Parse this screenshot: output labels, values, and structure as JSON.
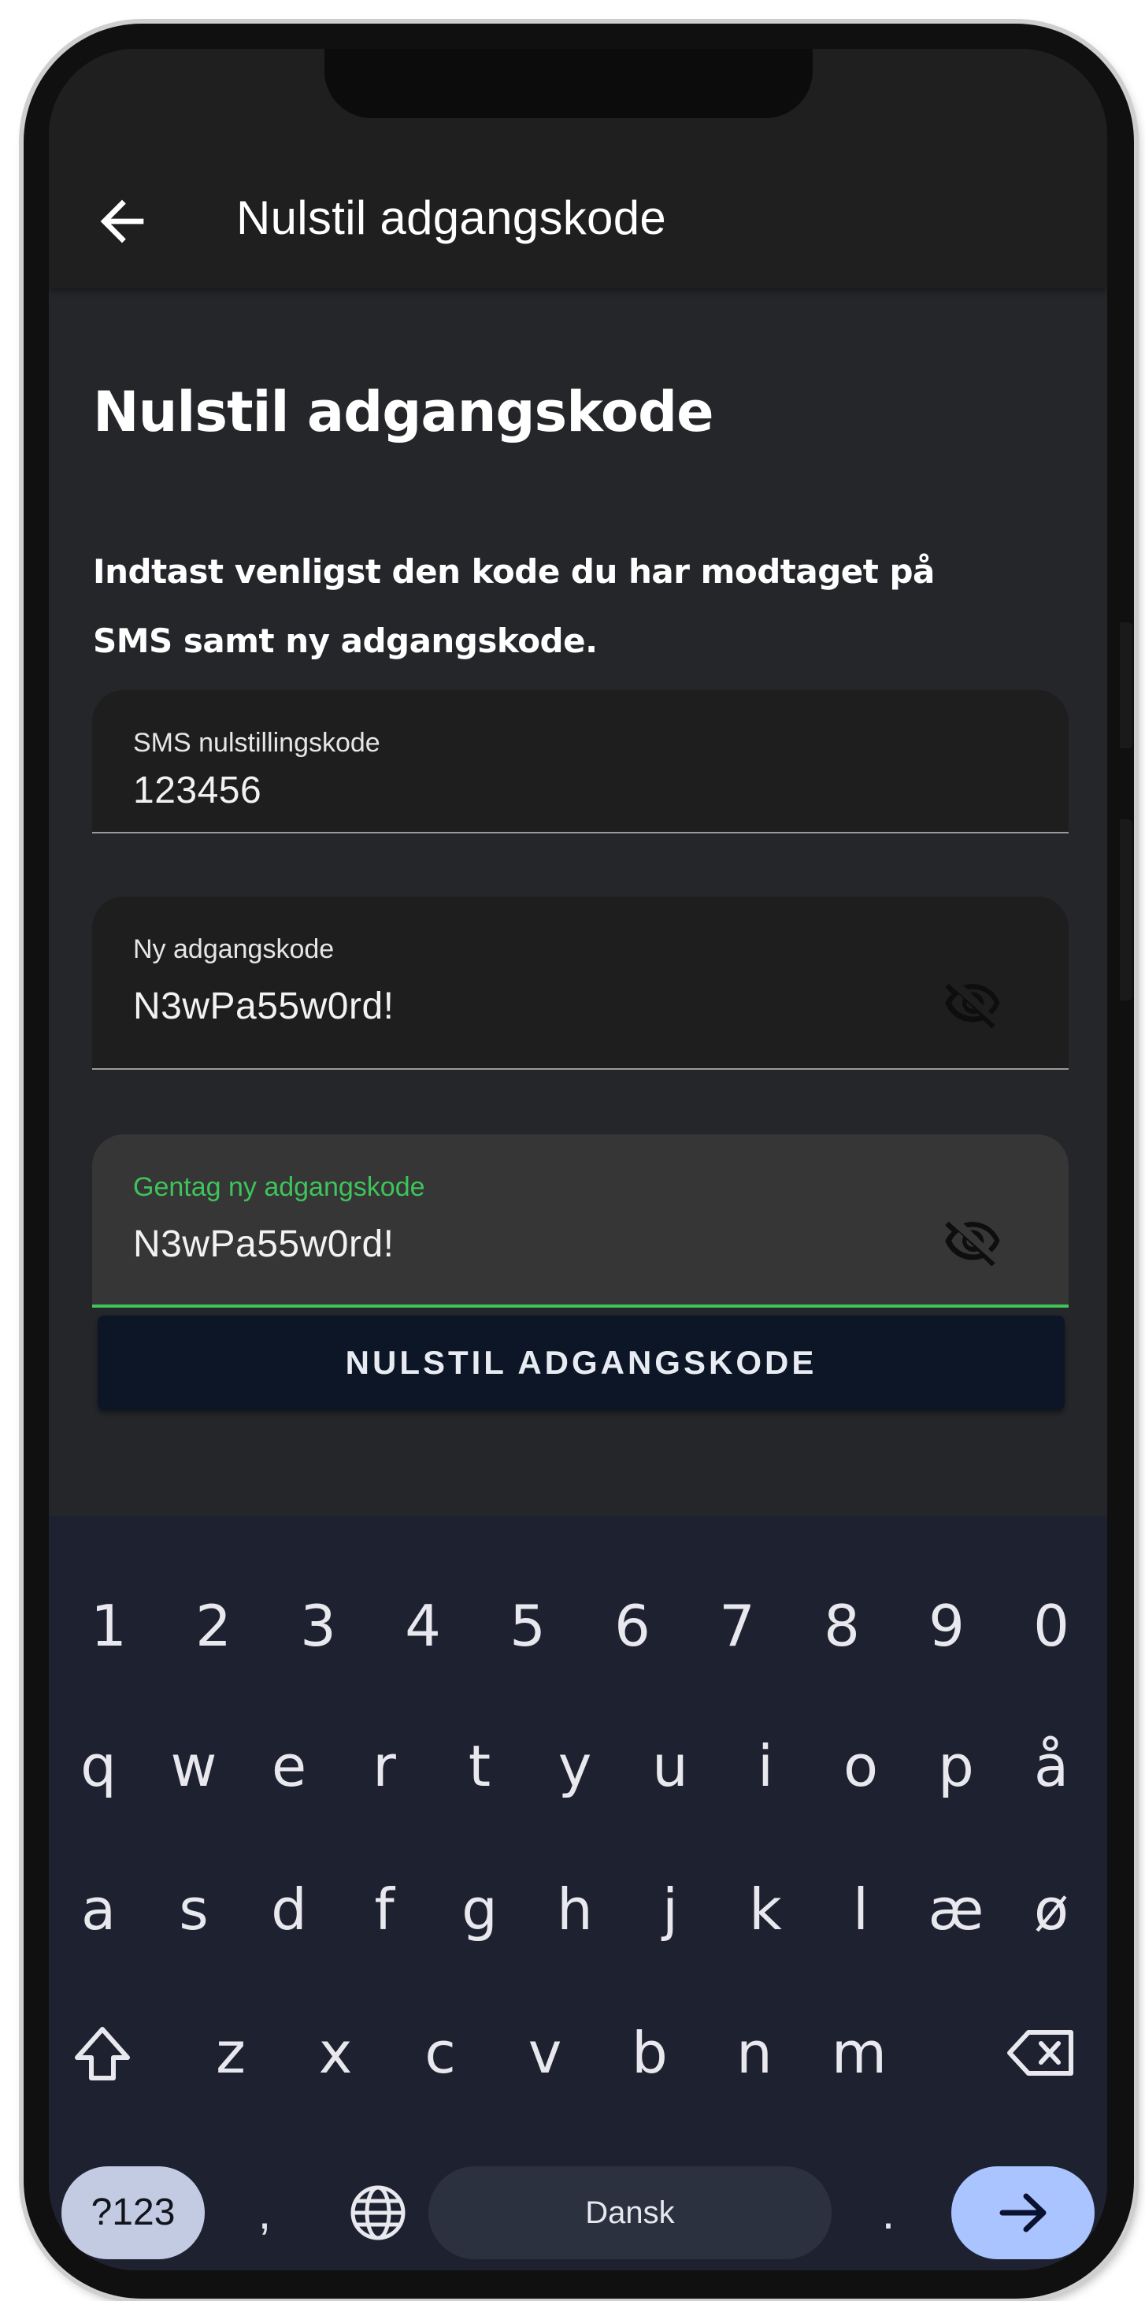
{
  "app_bar": {
    "title": "Nulstil adgangskode",
    "back_icon": "arrow-left-icon"
  },
  "content": {
    "heading": "Nulstil adgangskode",
    "description": "Indtast venligst den kode du har modtaget på SMS samt ny adgangskode."
  },
  "fields": {
    "sms_code": {
      "label": "SMS nulstillingskode",
      "value": "123456"
    },
    "new_password": {
      "label": "Ny adgangskode",
      "value": "N3wPa55w0rd!",
      "toggle_icon": "eye-off-icon"
    },
    "repeat_password": {
      "label": "Gentag ny adgangskode",
      "value": "N3wPa55w0rd!",
      "toggle_icon": "eye-off-icon",
      "focused": true
    }
  },
  "submit_button": {
    "label": "NULSTIL ADGANGSKODE"
  },
  "keyboard": {
    "number_row": [
      "1",
      "2",
      "3",
      "4",
      "5",
      "6",
      "7",
      "8",
      "9",
      "0"
    ],
    "row1": [
      "q",
      "w",
      "e",
      "r",
      "t",
      "y",
      "u",
      "i",
      "o",
      "p",
      "å"
    ],
    "row2": [
      "a",
      "s",
      "d",
      "f",
      "g",
      "h",
      "j",
      "k",
      "l",
      "æ",
      "ø"
    ],
    "row3": [
      "z",
      "x",
      "c",
      "v",
      "b",
      "n",
      "m"
    ],
    "symbols_key": "?123",
    "comma_key": ",",
    "period_key": ".",
    "space_label": "Dansk",
    "icons": {
      "shift": "shift-icon",
      "backspace": "backspace-icon",
      "language": "globe-icon",
      "enter": "arrow-right-icon"
    }
  },
  "colors": {
    "accent": "#3ec45a",
    "background": "#25262a",
    "app_bar": "#1f1f1f",
    "button": "#0c1626",
    "keyboard": "#1e2230",
    "enter_key": "#a9c4ff"
  }
}
